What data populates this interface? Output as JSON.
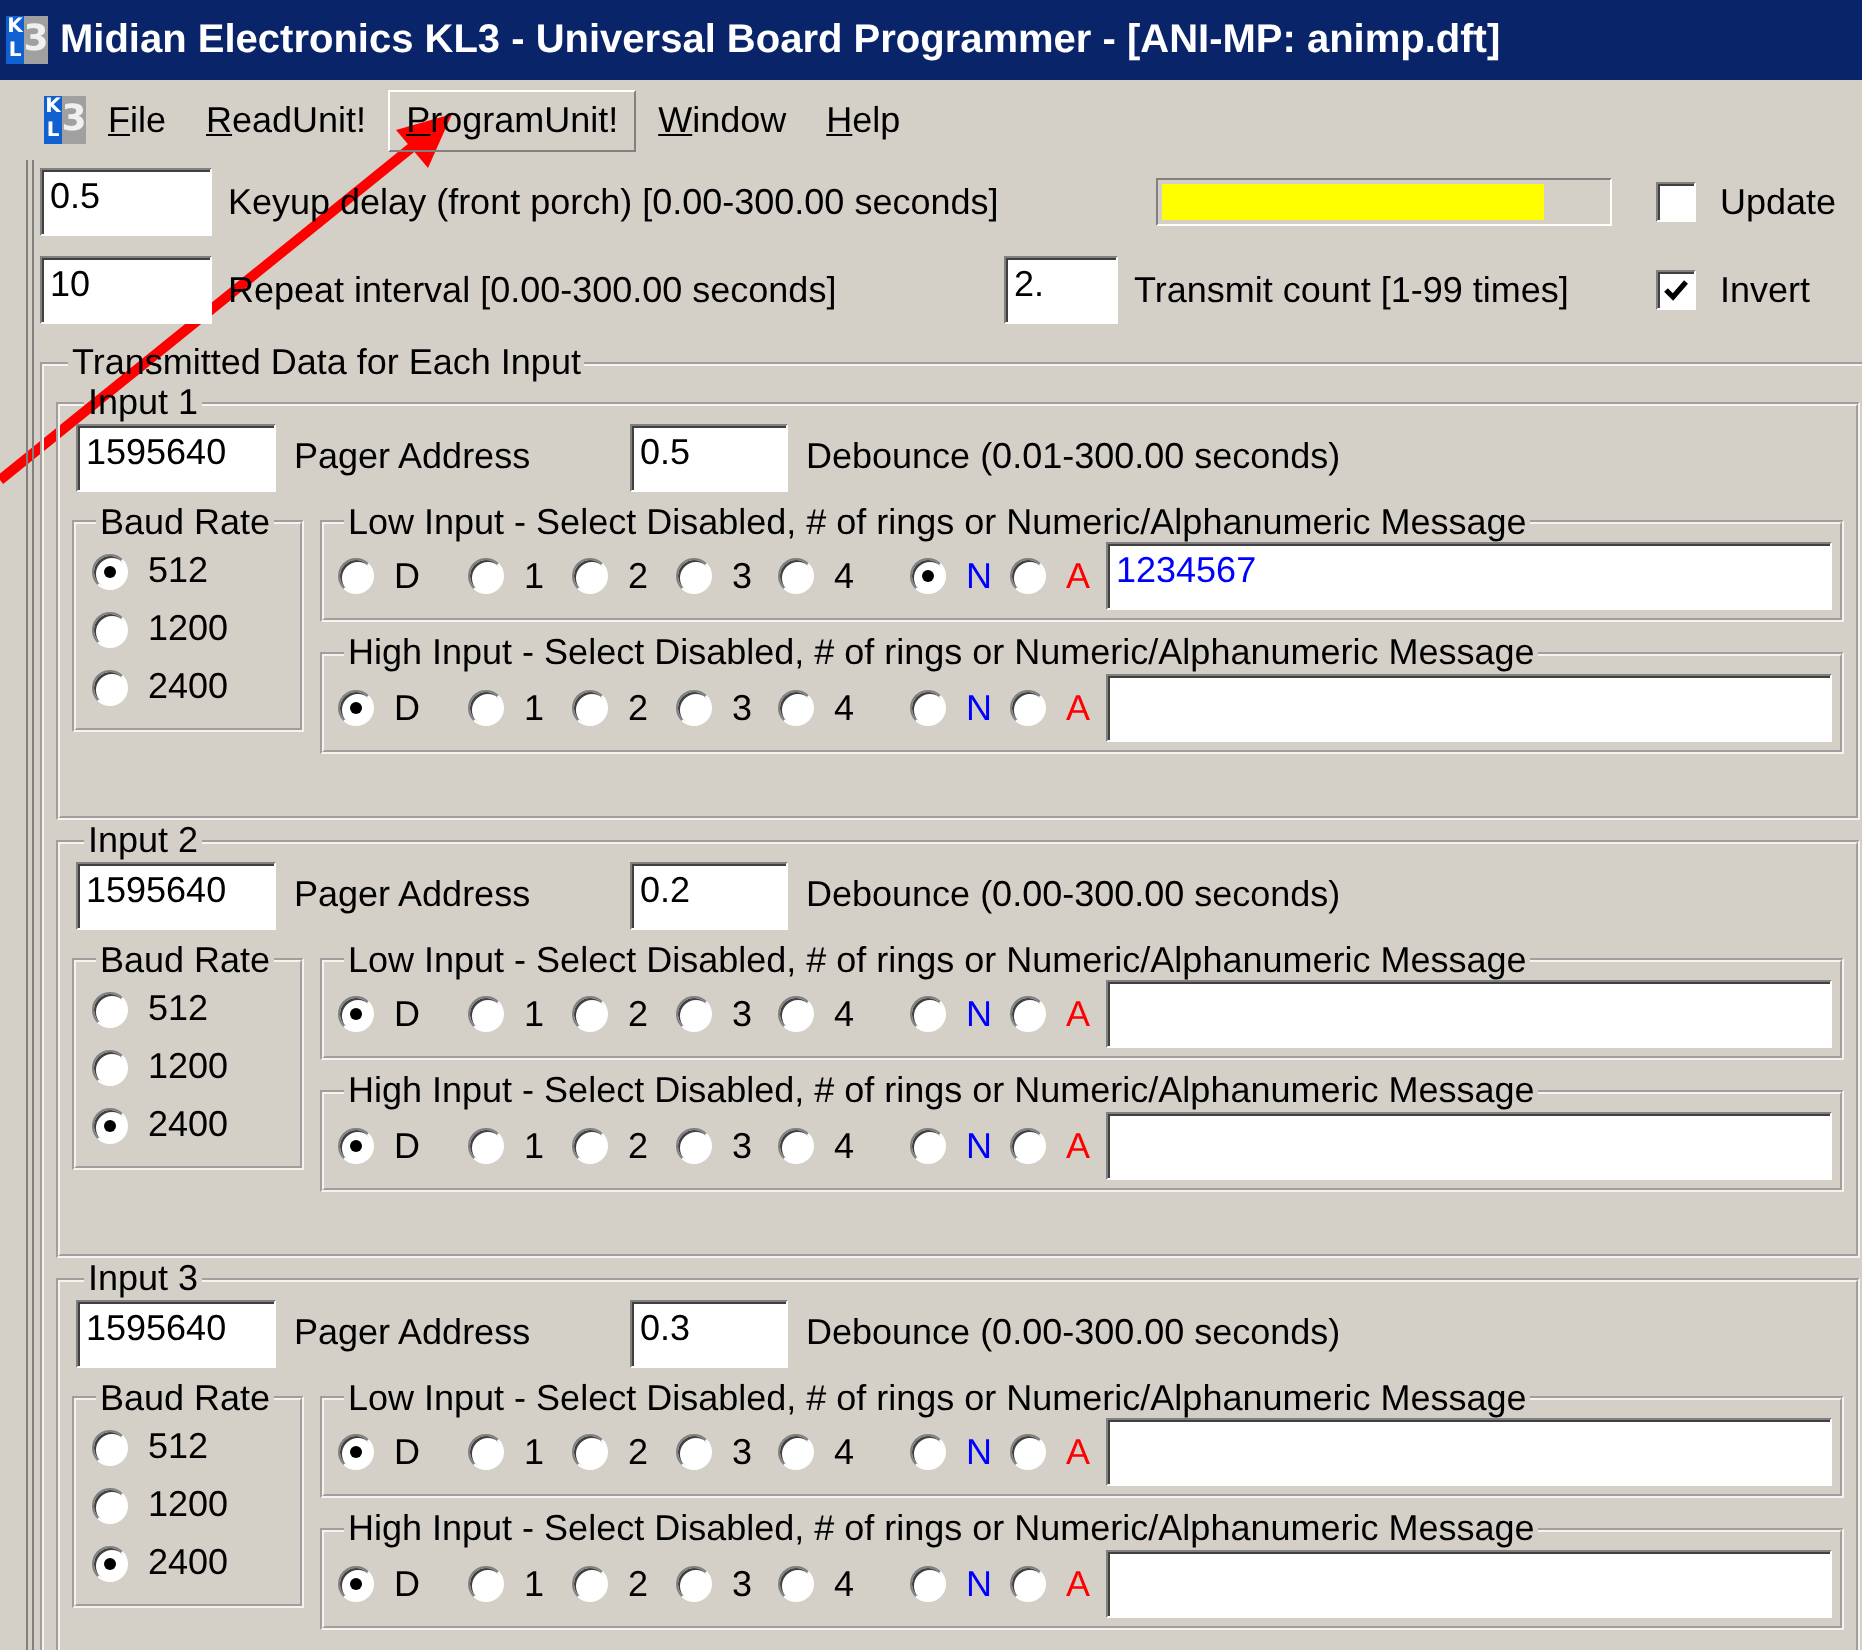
{
  "window": {
    "icon_letters": [
      "K",
      "L",
      "3"
    ],
    "title": "Midian Electronics KL3 - Universal Board Programmer - [ANI-MP: animp.dft]"
  },
  "menu_bar": {
    "icon_letters": [
      "K",
      "L",
      "3"
    ],
    "items": [
      {
        "label": "File",
        "highlighted": false
      },
      {
        "label": "ReadUnit!",
        "highlighted": false
      },
      {
        "label": "ProgramUnit!",
        "highlighted": true
      },
      {
        "label": "Window",
        "highlighted": false
      },
      {
        "label": "Help",
        "highlighted": false
      }
    ]
  },
  "settings": {
    "keyup_delay": {
      "value": "0.5",
      "label": "Keyup delay (front porch) [0.00-300.00 seconds]"
    },
    "progress": {
      "level": 0.86
    },
    "update": {
      "label": "Update",
      "checked": false
    },
    "repeat_interval": {
      "value": "10",
      "label": "Repeat interval [0.00-300.00 seconds]"
    },
    "transmit_count": {
      "value": "2.",
      "label": "Transmit count [1-99 times]"
    },
    "invert": {
      "label": "Invert",
      "checked": true
    }
  },
  "transmitted_data": {
    "title": "Transmitted Data for Each Input",
    "inputs": [
      {
        "title": "Input 1",
        "address": "1595640",
        "address_label": "Pager Address",
        "debounce": "0.5",
        "debounce_label": "Debounce (0.01-300.00 seconds)",
        "baud_rate": {
          "title": "Baud Rate",
          "options": [
            {
              "label": "512",
              "selected": true
            },
            {
              "label": "1200",
              "selected": false
            },
            {
              "label": "2400",
              "selected": false
            }
          ]
        },
        "messages": [
          {
            "title": "Low Input - Select Disabled, # of rings or Numeric/Alphanumeric Message",
            "options": [
              {
                "label": "D",
                "selected": false
              },
              {
                "label": "1",
                "selected": false
              },
              {
                "label": "2",
                "selected": false
              },
              {
                "label": "3",
                "selected": false
              },
              {
                "label": "4",
                "selected": false
              },
              {
                "label": "N",
                "selected": true,
                "color": "#0000ff"
              },
              {
                "label": "A",
                "selected": false,
                "color": "#ff0000"
              }
            ],
            "text": "1234567"
          },
          {
            "title": "High Input - Select Disabled, # of rings or Numeric/Alphanumeric Message",
            "options": [
              {
                "label": "D",
                "selected": true
              },
              {
                "label": "1",
                "selected": false
              },
              {
                "label": "2",
                "selected": false
              },
              {
                "label": "3",
                "selected": false
              },
              {
                "label": "4",
                "selected": false
              },
              {
                "label": "N",
                "selected": false,
                "color": "#0000ff"
              },
              {
                "label": "A",
                "selected": false,
                "color": "#ff0000"
              }
            ]
          }
        ]
      },
      {
        "title": "Input 2",
        "address": "1595640",
        "address_label": "Pager Address",
        "debounce": "0.2",
        "debounce_label": "Debounce (0.00-300.00 seconds)",
        "baud_rate": {
          "title": "Baud Rate",
          "options": [
            {
              "label": "512",
              "selected": false
            },
            {
              "label": "1200",
              "selected": false
            },
            {
              "label": "2400",
              "selected": true
            }
          ]
        },
        "messages": [
          {
            "title": "Low Input - Select Disabled, # of rings or Numeric/Alphanumeric Message",
            "options": [
              {
                "label": "D",
                "selected": true
              },
              {
                "label": "1",
                "selected": false
              },
              {
                "label": "2",
                "selected": false
              },
              {
                "label": "3",
                "selected": false
              },
              {
                "label": "4",
                "selected": false
              },
              {
                "label": "N",
                "selected": false,
                "color": "#0000ff"
              },
              {
                "label": "A",
                "selected": false,
                "color": "#ff0000"
              }
            ]
          },
          {
            "title": "High Input - Select Disabled, # of rings or Numeric/Alphanumeric Message",
            "options": [
              {
                "label": "D",
                "selected": true
              },
              {
                "label": "1",
                "selected": false
              },
              {
                "label": "2",
                "selected": false
              },
              {
                "label": "3",
                "selected": false
              },
              {
                "label": "4",
                "selected": false
              },
              {
                "label": "N",
                "selected": false,
                "color": "#0000ff"
              },
              {
                "label": "A",
                "selected": false,
                "color": "#ff0000"
              }
            ]
          }
        ]
      },
      {
        "title": "Input 3",
        "address": "1595640",
        "address_label": "Pager Address",
        "debounce": "0.3",
        "debounce_label": "Debounce (0.00-300.00 seconds)",
        "baud_rate": {
          "title": "Baud Rate",
          "options": [
            {
              "label": "512",
              "selected": false
            },
            {
              "label": "1200",
              "selected": false
            },
            {
              "label": "2400",
              "selected": true
            }
          ]
        },
        "messages": [
          {
            "title": "Low Input - Select Disabled, # of rings or Numeric/Alphanumeric Message",
            "options": [
              {
                "label": "D",
                "selected": true
              },
              {
                "label": "1",
                "selected": false
              },
              {
                "label": "2",
                "selected": false
              },
              {
                "label": "3",
                "selected": false
              },
              {
                "label": "4",
                "selected": false
              },
              {
                "label": "N",
                "selected": false,
                "color": "#0000ff"
              },
              {
                "label": "A",
                "selected": false,
                "color": "#ff0000"
              }
            ]
          },
          {
            "title": "High Input - Select Disabled, # of rings or Numeric/Alphanumeric Message",
            "options": [
              {
                "label": "D",
                "selected": true
              },
              {
                "label": "1",
                "selected": false
              },
              {
                "label": "2",
                "selected": false
              },
              {
                "label": "3",
                "selected": false
              },
              {
                "label": "4",
                "selected": false
              },
              {
                "label": "N",
                "selected": false,
                "color": "#0000ff"
              },
              {
                "label": "A",
                "selected": false,
                "color": "#ff0000"
              }
            ]
          }
        ]
      }
    ]
  },
  "annotation": {
    "kind": "arrow",
    "color": "#ff0000"
  }
}
